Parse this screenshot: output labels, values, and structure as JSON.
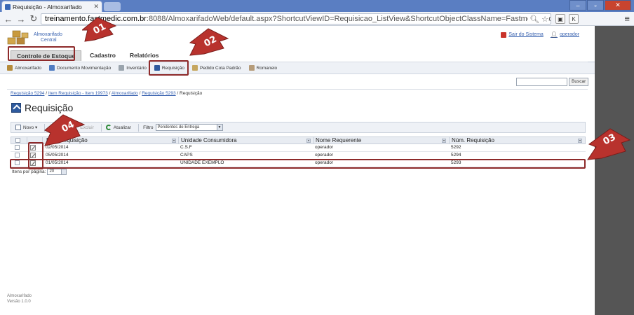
{
  "browser": {
    "tab_title": "Requisição - Almoxarifado",
    "url_host": "treinamento.fastmedic.com.br",
    "url_rest": ":8088/AlmoxarifadoWeb/default.aspx?ShortcutViewID=Requisicao_ListView&ShortcutObjectClassName=Fastmedic.Administrativ"
  },
  "app": {
    "logo_line1": "Almoxarifado",
    "logo_line2": "Central",
    "sair_label": "Sair do Sistema",
    "user_label": "operador"
  },
  "main_menu": [
    "Controle de Estoque",
    "Cadastro",
    "Relatórios"
  ],
  "sub_menu": [
    "Almoxarifado",
    "Documento Movimentação",
    "Inventário",
    "Requisição",
    "Pedido Cota Padrão",
    "Romaneio"
  ],
  "search": {
    "button": "Buscar",
    "placeholder": ""
  },
  "breadcrumb": {
    "items": [
      "Requisição 5294",
      "Item Requisição - Item 19973",
      "Almoxarifado",
      "Requisição 5293"
    ],
    "current": "Requisição"
  },
  "page_title": "Requisição",
  "grid_toolbar": {
    "novo": "Novo",
    "excluir": "Excluir",
    "atualizar": "Atualizar",
    "filtro_label": "Filtro",
    "filtro_value": "Pendentes de Entrega"
  },
  "grid": {
    "headers": [
      "Data Requisição",
      "Unidade Consumidora",
      "Nome Requerente",
      "Núm. Requisição"
    ],
    "rows": [
      {
        "data": "02/05/2014",
        "unidade": "C.S.F",
        "nome": "operador",
        "num": "5292"
      },
      {
        "data": "05/05/2014",
        "unidade": "CAPS",
        "nome": "operador",
        "num": "5294"
      },
      {
        "data": "01/05/2014",
        "unidade": "UNIDADE EXEMPLO",
        "nome": "operador",
        "num": "5293"
      }
    ]
  },
  "pager": {
    "label": "Itens por página:",
    "value": "20"
  },
  "footer": {
    "line1": "Almoxarifado",
    "line2": "Versão 1.0.0"
  },
  "annotations": [
    "01",
    "02",
    "03",
    "04"
  ],
  "colors": {
    "callout": "#b8322d",
    "highlight": "#8e2a2a",
    "link": "#3a63b0"
  }
}
